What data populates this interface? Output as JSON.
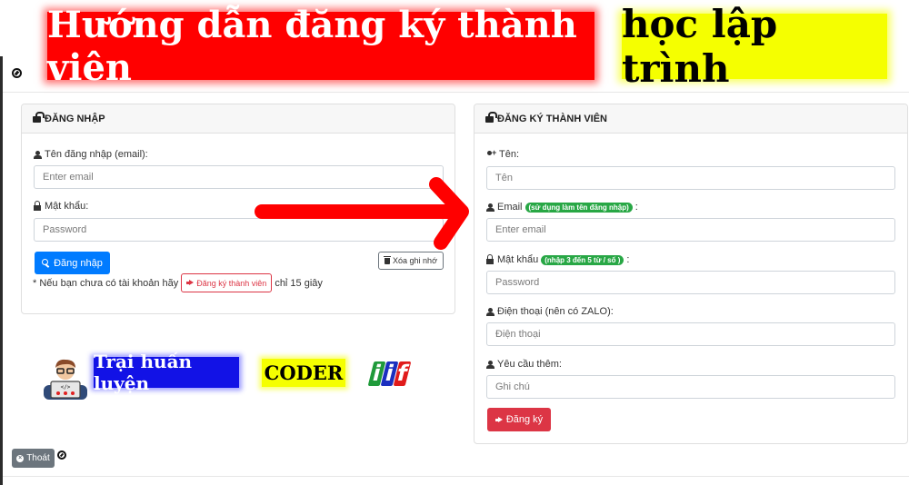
{
  "banner": {
    "title_red": "Hướng dẫn đăng ký thành viên",
    "title_yellow": "học lập trình",
    "colors": {
      "red": "#ff0000",
      "yellow": "#f5ff00"
    }
  },
  "login": {
    "header": "ĐĂNG NHẬP",
    "username_label": "Tên đăng nhập (email):",
    "username_placeholder": "Enter email",
    "password_label": "Mật khẩu:",
    "password_placeholder": "Password",
    "submit_label": "Đăng nhập",
    "clear_label": "Xóa ghi nhớ",
    "hint_prefix": "* Nếu bạn chưa có tài khoản hãy",
    "register_link_label": "Đăng ký thành viên",
    "hint_suffix": "chỉ 15 giây"
  },
  "register": {
    "header": "ĐĂNG KÝ THÀNH VIÊN",
    "name_label": "Tên:",
    "name_placeholder": "Tên",
    "email_label": "Email",
    "email_badge": "(sử dụng làm tên đăng nhập)",
    "email_placeholder": "Enter email",
    "password_label": "Mật khẩu",
    "password_badge": "(nhập 3 đến 5 từ / số )",
    "password_placeholder": "Password",
    "phone_label": "Điện thoại (nên có ZALO):",
    "phone_placeholder": "Điện thoại",
    "note_label": "Yêu cầu thêm:",
    "note_placeholder": "Ghi chú",
    "submit_label": "Đăng ký",
    "colon": ":"
  },
  "promo": {
    "blue_tag": "Trại huấn luyện",
    "yellow_tag": "CODER",
    "logo_letters": [
      "i",
      "i",
      "f"
    ],
    "logo_colors": [
      "#1f9a3a",
      "#1a2fbf",
      "#e01b1b"
    ]
  },
  "footer": {
    "logout_label": "Thoát"
  },
  "colors": {
    "primary": "#007bff",
    "danger": "#dc3545",
    "success": "#28a745",
    "secondary": "#6c757d"
  }
}
